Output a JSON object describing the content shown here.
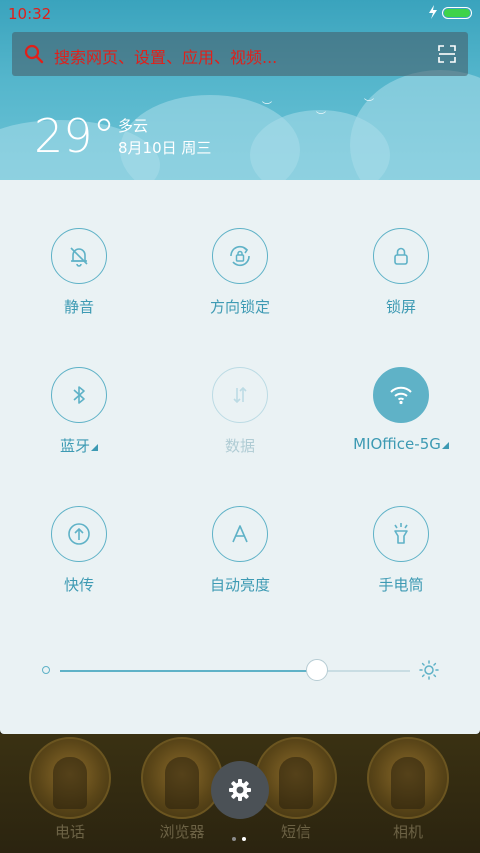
{
  "status_bar": {
    "time": "10:32",
    "battery_level": 1.0
  },
  "search": {
    "placeholder": "搜索网页、设置、应用、视频..."
  },
  "weather": {
    "temperature": "29°",
    "condition": "多云",
    "date": "8月10日 周三"
  },
  "toggles": [
    {
      "label": "静音",
      "icon": "mute-bell-icon",
      "state": "off"
    },
    {
      "label": "方向锁定",
      "icon": "rotation-lock-icon",
      "state": "off"
    },
    {
      "label": "锁屏",
      "icon": "lock-icon",
      "state": "off"
    },
    {
      "label": "蓝牙",
      "icon": "bluetooth-icon",
      "state": "off",
      "has_menu": true
    },
    {
      "label": "数据",
      "icon": "mobile-data-icon",
      "state": "disabled"
    },
    {
      "label": "MIOffice-5G",
      "icon": "wifi-icon",
      "state": "on",
      "has_menu": true
    },
    {
      "label": "快传",
      "icon": "quick-share-icon",
      "state": "off"
    },
    {
      "label": "自动亮度",
      "icon": "auto-brightness-icon",
      "state": "off"
    },
    {
      "label": "手电筒",
      "icon": "flashlight-icon",
      "state": "off"
    }
  ],
  "brightness": {
    "level": 0.735
  },
  "dock": [
    {
      "label": "电话"
    },
    {
      "label": "浏览器"
    },
    {
      "label": "短信"
    },
    {
      "label": "相机"
    }
  ],
  "pager": {
    "pages": 2,
    "current": 2
  },
  "colors": {
    "accent": "#5fb2c7",
    "label": "#3d9ab3",
    "status_red": "#e0201a",
    "battery_green": "#3fd34a"
  }
}
